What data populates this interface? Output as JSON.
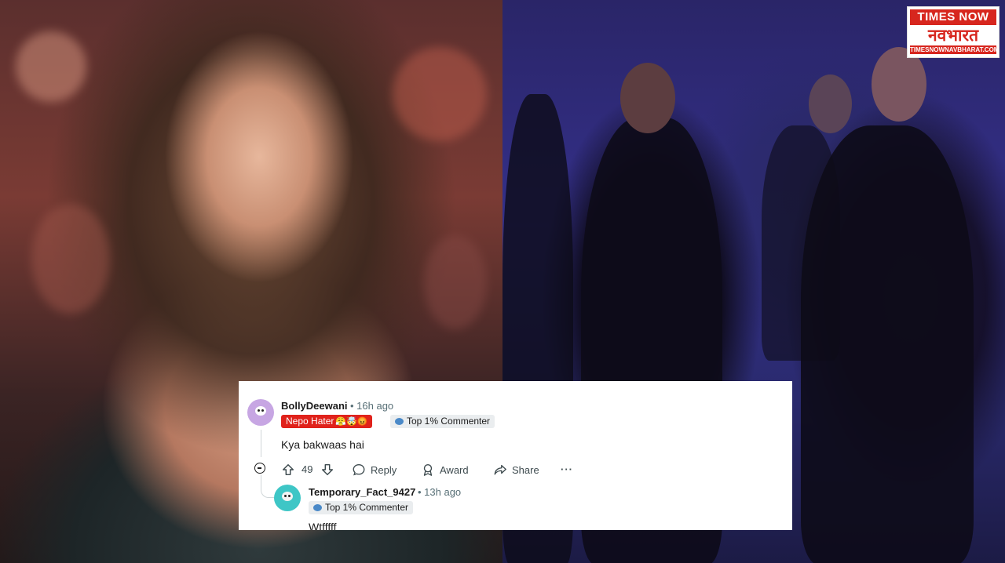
{
  "logo": {
    "top_text": "TIMES NOW",
    "main_text": "नवभारत",
    "url_text": "TIMESNOWNAVBHARAT.COM"
  },
  "comment": {
    "username": "BollyDeewani",
    "time": "• 16h ago",
    "flair_main": "Nepo Hater",
    "flair_emoji": "😤🤯😡",
    "flair_badge": "Top 1% Commenter",
    "body": "Kya bakwaas hai",
    "vote_count": "49",
    "actions": {
      "reply": "Reply",
      "award": "Award",
      "share": "Share",
      "more": "···"
    }
  },
  "reply": {
    "username": "Temporary_Fact_9427",
    "time": "• 13h ago",
    "flair_badge": "Top 1% Commenter",
    "body": "Wtfffff"
  },
  "colors": {
    "flair_red": "#e0221b",
    "brand_red": "#d7261e",
    "avatar1": "#c7a6e3",
    "avatar2": "#3ec6c6"
  }
}
